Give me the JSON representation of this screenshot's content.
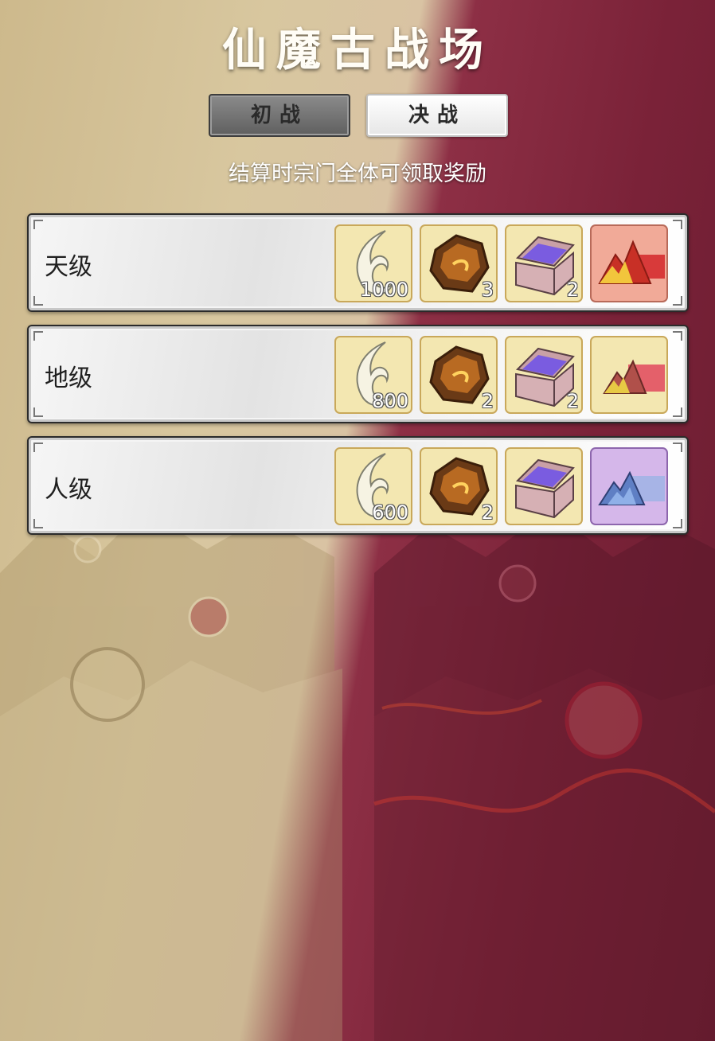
{
  "header": {
    "title": "仙魔古战场"
  },
  "tabs": [
    {
      "label": "初战",
      "selected": false
    },
    {
      "label": "决战",
      "selected": true
    }
  ],
  "subtitle": "结算时宗门全体可领取奖励",
  "rows": [
    {
      "label": "天级",
      "items": [
        {
          "icon": "jade-crescent-icon",
          "qty": "1000"
        },
        {
          "icon": "ore-stone-icon",
          "qty": "3"
        },
        {
          "icon": "treasure-chest-icon",
          "qty": "2"
        },
        {
          "icon": "fire-mountain-icon",
          "qty": ""
        }
      ],
      "special_color": "#f1aa98"
    },
    {
      "label": "地级",
      "items": [
        {
          "icon": "jade-crescent-icon",
          "qty": "800"
        },
        {
          "icon": "ore-stone-icon",
          "qty": "2"
        },
        {
          "icon": "treasure-chest-icon",
          "qty": "2"
        },
        {
          "icon": "golden-mountain-icon",
          "qty": ""
        }
      ],
      "special_color": "#f3e7b1"
    },
    {
      "label": "人级",
      "items": [
        {
          "icon": "jade-crescent-icon",
          "qty": "600"
        },
        {
          "icon": "ore-stone-icon",
          "qty": "2"
        },
        {
          "icon": "treasure-chest-icon",
          "qty": ""
        },
        {
          "icon": "ice-mountain-icon",
          "qty": ""
        }
      ],
      "special_color": "#d5b7ea"
    }
  ],
  "colors": {
    "left_theme": "#d8c79f",
    "right_theme": "#7a2238",
    "item_slot": "#f3e7b1"
  }
}
